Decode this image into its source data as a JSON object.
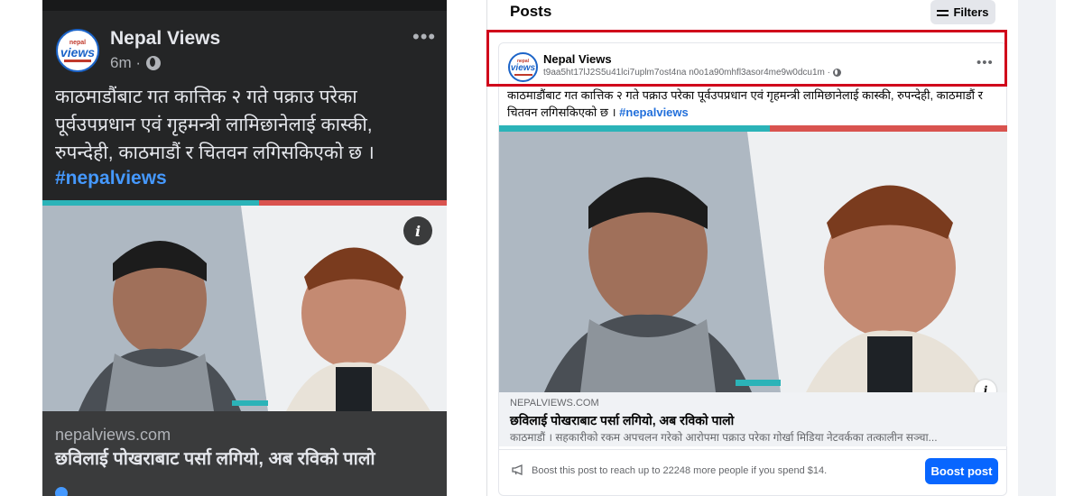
{
  "mobile_post": {
    "page_name": "Nepal Views",
    "time": "6m ·",
    "text": "काठमाडौंबाट गत कात्तिक २ गते पक्राउ परेका पूर्वउपप्रधान एवं गृहमन्त्री लामिछानेलाई कास्की, रुपन्देही, काठमाडौं र चितवन लगिसकिएको छ ।",
    "hashtag": "#nepalviews",
    "link_domain": "nepalviews.com",
    "link_headline": "छविलाई पोखराबाट पर्सा लगियो, अब रविको पालो",
    "more_icon": "more-horizontal-icon",
    "info_icon": "info-icon"
  },
  "desktop": {
    "section_title": "Posts",
    "filters_label": "Filters",
    "post": {
      "page_name": "Nepal Views",
      "post_id": "t9aa5ht17lJ2S5u41lci7uplm7ost4na n0o1a90mhfl3asor4me9w0dcu1m ·",
      "text": "काठमाडौंबाट गत कात्तिक २ गते पक्राउ परेका पूर्वउपप्रधान एवं गृहमन्त्री लामिछानेलाई कास्की, रुपन्देही, काठमाडौं र चितवन लगिसकिएको छ ।",
      "hashtag": "#nepalviews",
      "link_domain": "NEPALVIEWS.COM",
      "link_headline": "छविलाई पोखराबाट पर्सा लगियो, अब रविको पालो",
      "link_desc": "काठमाडौं । सहकारीको रकम अपचलन गरेको आरोपमा पक्राउ परेका गोर्खा मिडिया नेटवर्कका तत्कालीन सञ्चा...",
      "boost_text": "Boost this post to reach up to 22248 more people if you spend $14.",
      "boost_button": "Boost post"
    }
  },
  "logo": {
    "small": "nepal",
    "main": "views"
  },
  "colors": {
    "accent": "#0866ff",
    "highlight": "#d0021b",
    "hashtag_dark": "#4599ff",
    "hashtag_light": "#216fdb"
  }
}
